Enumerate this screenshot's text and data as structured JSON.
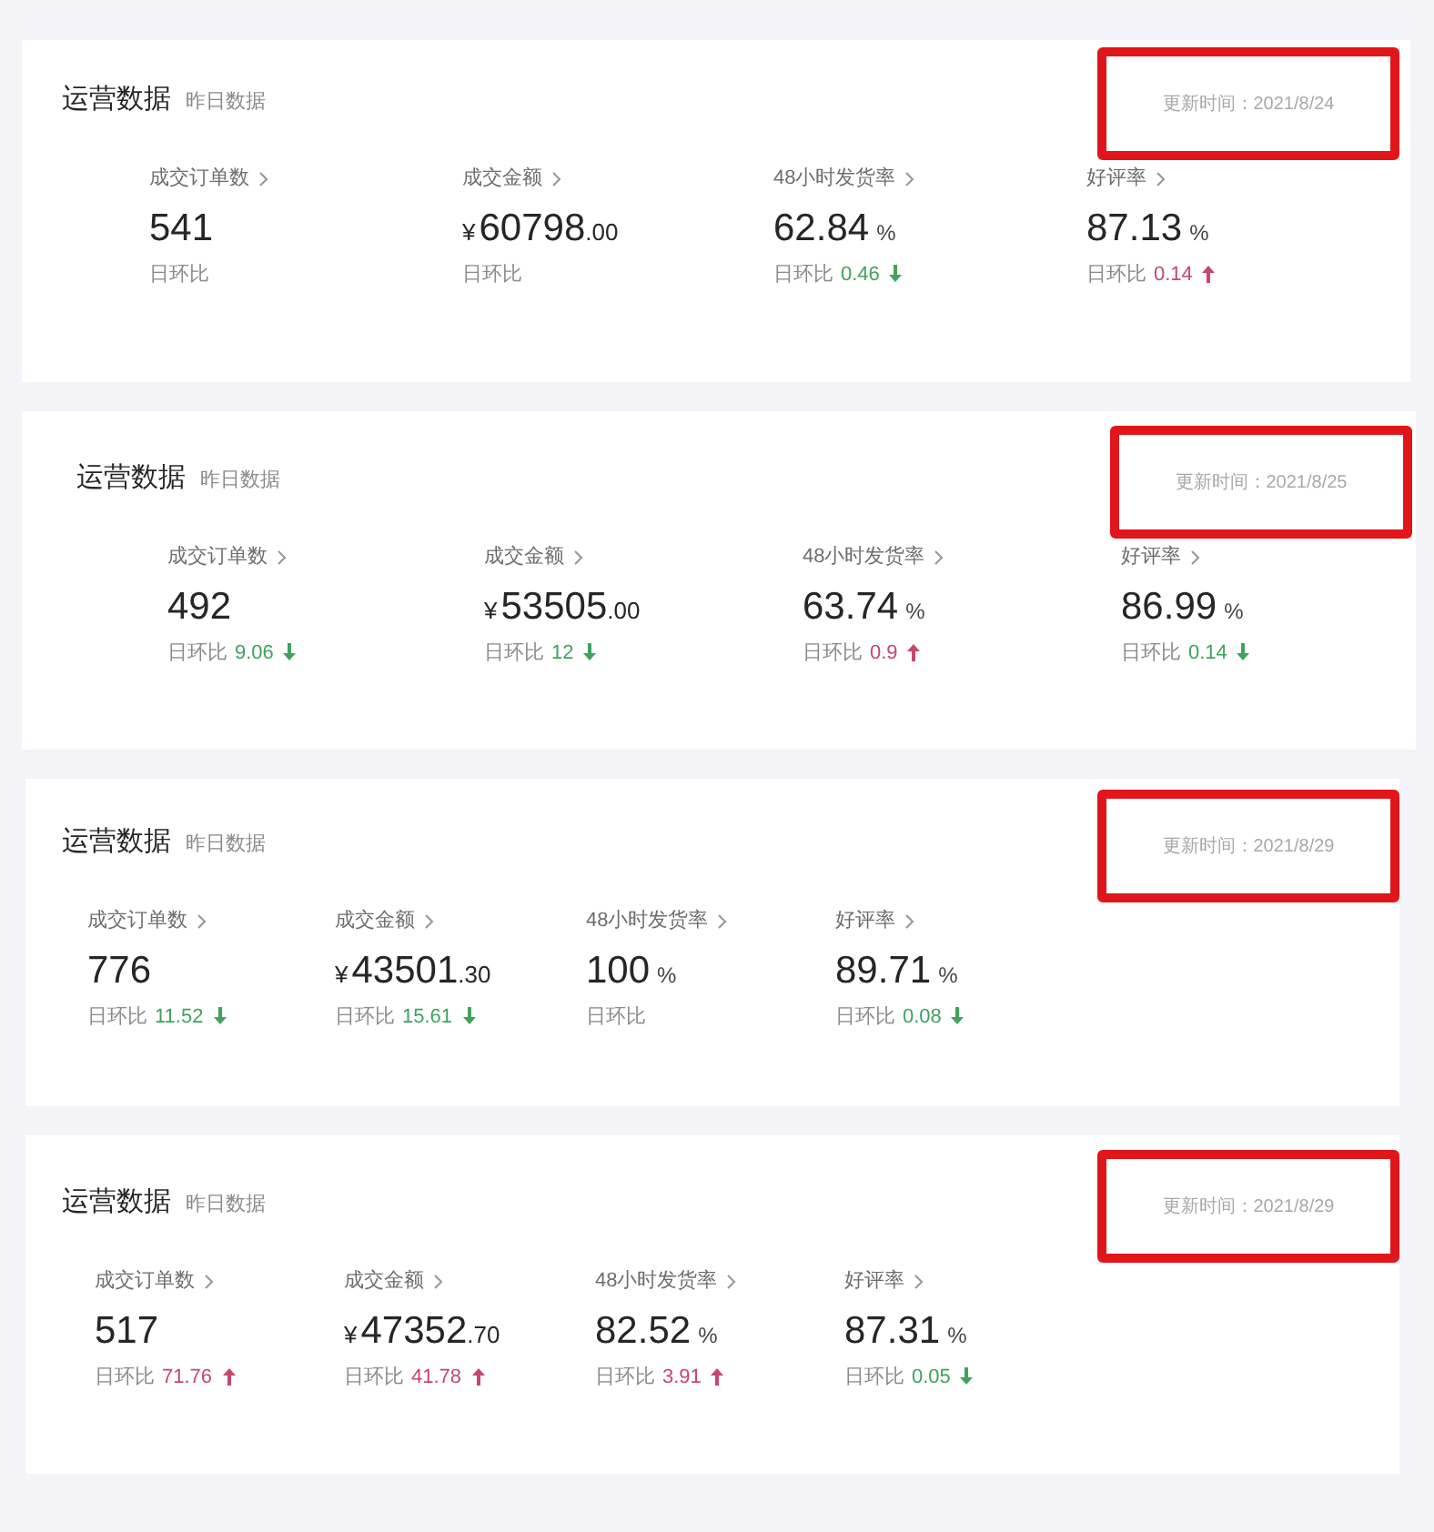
{
  "cards": [
    {
      "title": "运营数据",
      "subtitle": "昨日数据",
      "update_time": "更新时间：2021/8/24",
      "highlighted": true,
      "metrics": [
        {
          "kind": "flat",
          "label": "成交订单数",
          "value": "541",
          "change_label": "日环比"
        },
        {
          "kind": "flat",
          "label": "成交金额",
          "currency": "¥",
          "value": "60798",
          "decimals": ".00",
          "change_label": "日环比"
        },
        {
          "kind": "fall",
          "label": "48小时发货率",
          "value": "62.84",
          "unit": "%",
          "change_label": "日环比",
          "change": "0.46"
        },
        {
          "kind": "rise",
          "label": "好评率",
          "value": "87.13",
          "unit": "%",
          "change_label": "日环比",
          "change": "0.14"
        }
      ]
    },
    {
      "title": "运营数据",
      "subtitle": "昨日数据",
      "update_time": "更新时间：2021/8/25",
      "highlighted": true,
      "metrics": [
        {
          "kind": "fall",
          "label": "成交订单数",
          "value": "492",
          "change_label": "日环比",
          "change": "9.06"
        },
        {
          "kind": "fall",
          "label": "成交金额",
          "currency": "¥",
          "value": "53505",
          "decimals": ".00",
          "change_label": "日环比",
          "change": "12"
        },
        {
          "kind": "rise",
          "label": "48小时发货率",
          "value": "63.74",
          "unit": "%",
          "change_label": "日环比",
          "change": "0.9"
        },
        {
          "kind": "fall",
          "label": "好评率",
          "value": "86.99",
          "unit": "%",
          "change_label": "日环比",
          "change": "0.14"
        }
      ]
    },
    {
      "title": "运营数据",
      "subtitle": "昨日数据",
      "update_time": "更新时间：2021/8/29",
      "highlighted": true,
      "metrics": [
        {
          "kind": "fall",
          "label": "成交订单数",
          "value": "776",
          "change_label": "日环比",
          "change": "11.52"
        },
        {
          "kind": "fall",
          "label": "成交金额",
          "currency": "¥",
          "value": "43501",
          "decimals": ".30",
          "change_label": "日环比",
          "change": "15.61"
        },
        {
          "kind": "flat",
          "label": "48小时发货率",
          "value": "100",
          "unit": "%",
          "change_label": "日环比"
        },
        {
          "kind": "fall",
          "label": "好评率",
          "value": "89.71",
          "unit": "%",
          "change_label": "日环比",
          "change": "0.08"
        }
      ]
    },
    {
      "title": "运营数据",
      "subtitle": "昨日数据",
      "update_time": "更新时间：2021/8/29",
      "highlighted": true,
      "metrics": [
        {
          "kind": "rise",
          "label": "成交订单数",
          "value": "517",
          "change_label": "日环比",
          "change": "71.76"
        },
        {
          "kind": "rise",
          "label": "成交金额",
          "currency": "¥",
          "value": "47352",
          "decimals": ".70",
          "change_label": "日环比",
          "change": "41.78"
        },
        {
          "kind": "rise",
          "label": "48小时发货率",
          "value": "82.52",
          "unit": "%",
          "change_label": "日环比",
          "change": "3.91"
        },
        {
          "kind": "fall",
          "label": "好评率",
          "value": "87.31",
          "unit": "%",
          "change_label": "日环比",
          "change": "0.05"
        }
      ]
    }
  ]
}
